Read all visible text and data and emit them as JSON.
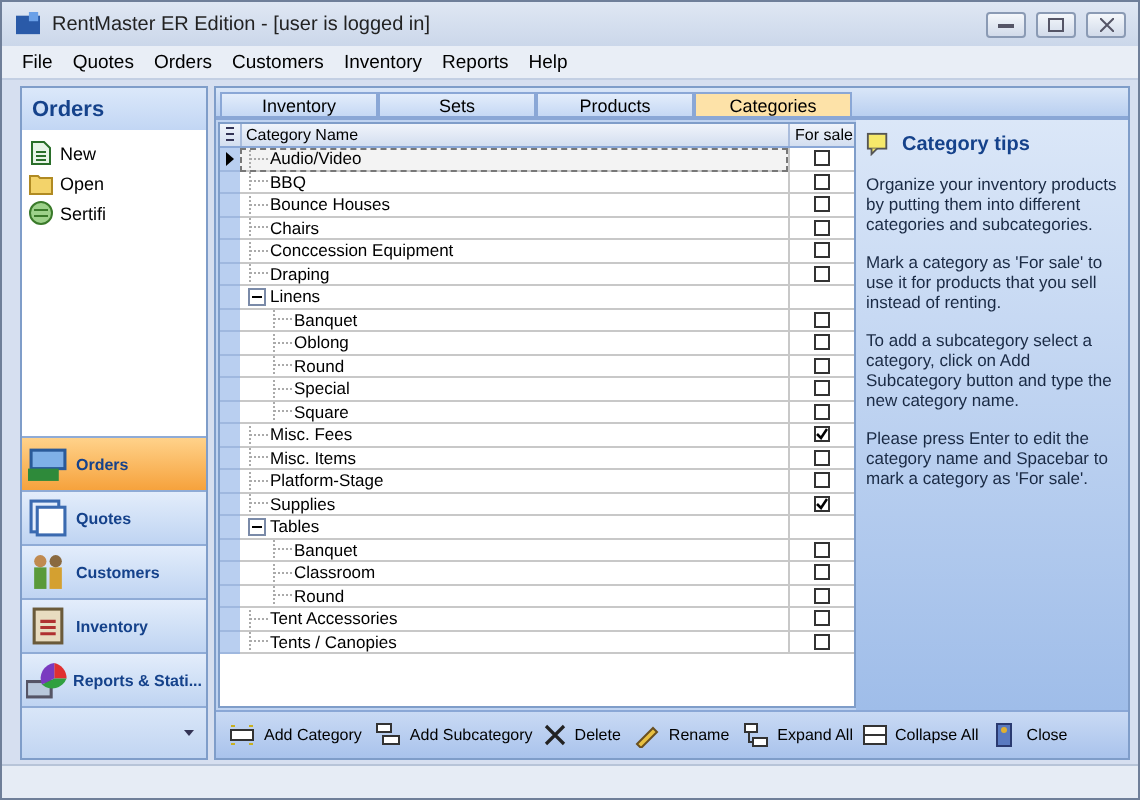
{
  "window": {
    "title": "RentMaster ER Edition - [user is logged in]"
  },
  "menu": [
    "File",
    "Quotes",
    "Orders",
    "Customers",
    "Inventory",
    "Reports",
    "Help"
  ],
  "sidebar": {
    "title": "Orders",
    "links": [
      {
        "label": "New",
        "kind": "new"
      },
      {
        "label": "Open",
        "kind": "open"
      },
      {
        "label": "Sertifi",
        "kind": "sertifi"
      }
    ],
    "nav": [
      {
        "label": "Orders",
        "kind": "orders",
        "selected": true
      },
      {
        "label": "Quotes",
        "kind": "quotes",
        "selected": false
      },
      {
        "label": "Customers",
        "kind": "customers",
        "selected": false
      },
      {
        "label": "Inventory",
        "kind": "inventory",
        "selected": false
      },
      {
        "label": "Reports & Stati...",
        "kind": "reports",
        "selected": false
      }
    ]
  },
  "tabs": [
    {
      "label": "Inventory",
      "selected": false
    },
    {
      "label": "Sets",
      "selected": false
    },
    {
      "label": "Products",
      "selected": false
    },
    {
      "label": "Categories",
      "selected": true
    }
  ],
  "table": {
    "columns": [
      "Category Name",
      "For sale"
    ],
    "rows": [
      {
        "name": "Audio/Video",
        "for_sale": false,
        "selected": true
      },
      {
        "name": "BBQ",
        "for_sale": false,
        "selected": false
      },
      {
        "name": "Bounce Houses",
        "for_sale": false,
        "selected": false
      },
      {
        "name": "Chairs",
        "for_sale": false,
        "selected": false
      },
      {
        "name": "Conccession Equipment",
        "for_sale": false,
        "selected": false
      },
      {
        "name": "Draping",
        "for_sale": false,
        "selected": false
      },
      {
        "name": "Linens",
        "expanded": true,
        "selected": false,
        "children": [
          {
            "name": "Banquet",
            "for_sale": false,
            "selected": false
          },
          {
            "name": "Oblong",
            "for_sale": false,
            "selected": false
          },
          {
            "name": "Round",
            "for_sale": false,
            "selected": false
          },
          {
            "name": "Special",
            "for_sale": false,
            "selected": false
          },
          {
            "name": "Square",
            "for_sale": false,
            "selected": false
          }
        ]
      },
      {
        "name": "Misc. Fees",
        "for_sale": true,
        "selected": false
      },
      {
        "name": "Misc. Items",
        "for_sale": false,
        "selected": false
      },
      {
        "name": "Platform-Stage",
        "for_sale": false,
        "selected": false
      },
      {
        "name": "Supplies",
        "for_sale": true,
        "selected": false
      },
      {
        "name": "Tables",
        "expanded": true,
        "selected": false,
        "children": [
          {
            "name": "Banquet",
            "for_sale": false,
            "selected": false
          },
          {
            "name": "Classroom",
            "for_sale": false,
            "selected": false
          },
          {
            "name": "Round",
            "for_sale": false,
            "selected": false
          }
        ]
      },
      {
        "name": "Tent Accessories",
        "for_sale": false,
        "selected": false
      },
      {
        "name": "Tents / Canopies",
        "for_sale": false,
        "selected": false
      }
    ]
  },
  "tips": {
    "title": "Category tips",
    "paragraphs": [
      "Organize your inventory products by putting them into different categories and subcategories.",
      "Mark a category as 'For sale' to use it for products that you sell instead of renting.",
      "To add a subcategory select a category, click on Add Subcategory button and type the new category name.",
      "Please press Enter to edit the category name and Spacebar to mark a category as 'For sale'."
    ]
  },
  "toolbar": [
    {
      "label": "Add Category",
      "kind": "add"
    },
    {
      "label": "Add Subcategory",
      "kind": "addsub"
    },
    {
      "label": "Delete",
      "kind": "delete"
    },
    {
      "label": "Rename",
      "kind": "rename"
    },
    {
      "label": "Expand All",
      "kind": "expand"
    },
    {
      "label": "Collapse All",
      "kind": "collapse"
    },
    {
      "label": "Close",
      "kind": "close"
    }
  ]
}
